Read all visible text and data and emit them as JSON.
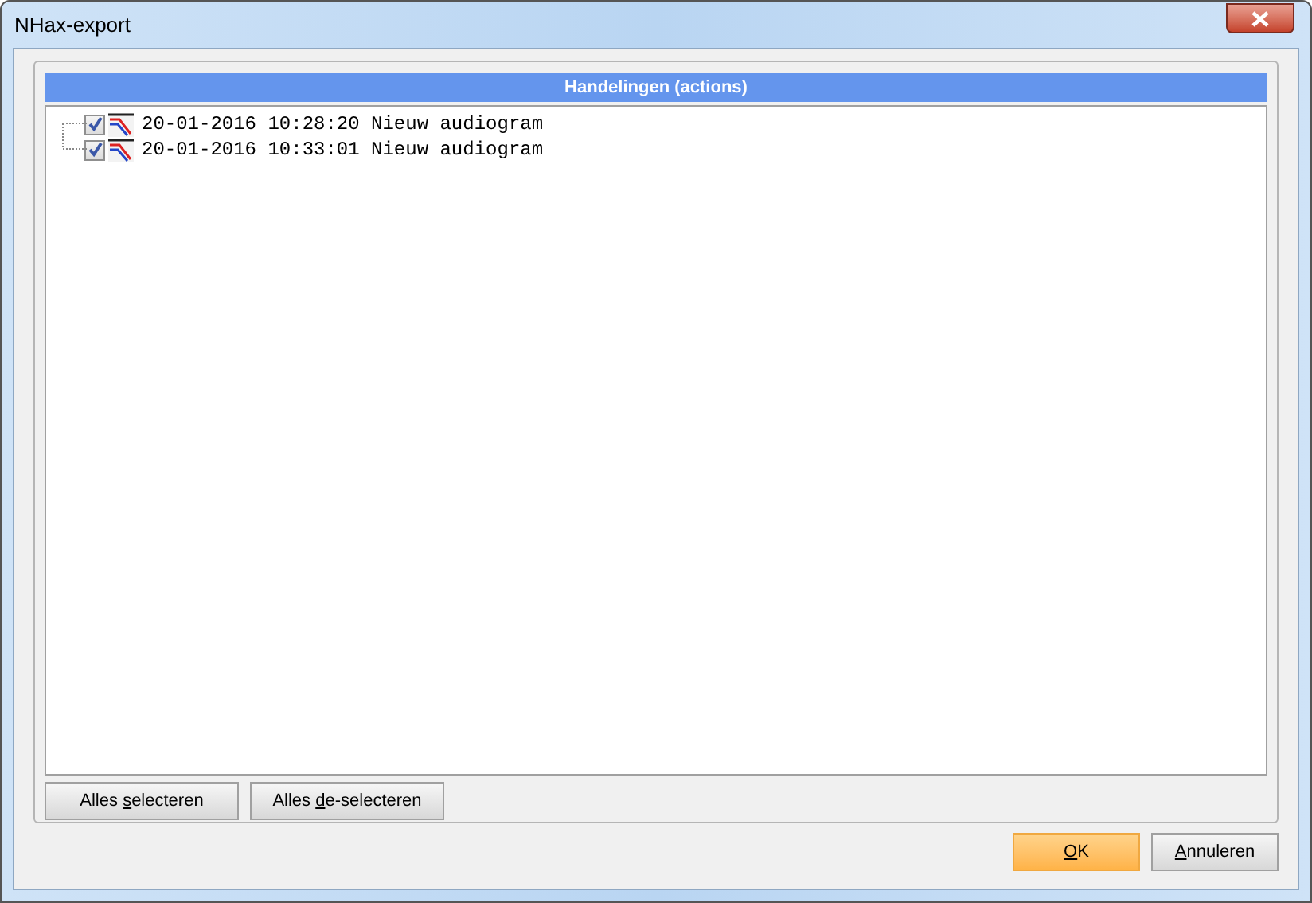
{
  "window": {
    "title": "NHax-export"
  },
  "panel": {
    "title": "Handelingen (actions)"
  },
  "tree": [
    {
      "label": "20-01-2016 10:28:20 Nieuw audiogram",
      "checked": true
    },
    {
      "label": "20-01-2016 10:33:01 Nieuw audiogram",
      "checked": true
    }
  ],
  "panel_buttons": [
    {
      "before": "Alles ",
      "key": "s",
      "after": "electeren",
      "default": false
    },
    {
      "before": "Alles ",
      "key": "d",
      "after": "e-selecteren",
      "default": false
    }
  ],
  "dialog_buttons": [
    {
      "key": "O",
      "after": "K",
      "default": true
    },
    {
      "key": "A",
      "after": "nnuleren",
      "default": false
    }
  ]
}
